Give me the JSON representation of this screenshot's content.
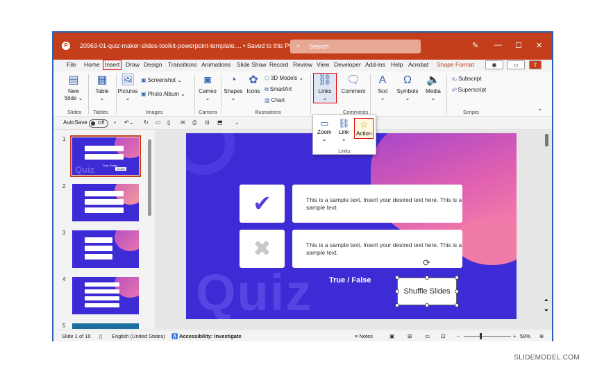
{
  "title_bar": {
    "logo": "P",
    "doc_title": "20963-01-quiz-maker-slides-toolkit-powerpoint-template....  •  Saved to this PC ⌄",
    "search_placeholder": "Search",
    "icons": [
      "pen-icon",
      "minimize-icon",
      "maximize-icon",
      "close-icon"
    ]
  },
  "menu": {
    "tabs": [
      "File",
      "Home",
      "Insert",
      "Draw",
      "Design",
      "Transitions",
      "Animations",
      "Slide Show",
      "Record",
      "Review",
      "View",
      "Developer",
      "Add-ins",
      "Help",
      "Acrobat",
      "Shape Format"
    ],
    "active_tab": "Insert"
  },
  "ribbon": {
    "new_slide": "New\nSlide ⌄",
    "table": "Table\n⌄",
    "pictures": "Pictures\n⌄",
    "screenshot": "Screenshot ⌄",
    "photo_album": "Photo Album ⌄",
    "cameo": "Cameo\n⌄",
    "shapes": "Shapes\n⌄",
    "icons": "Icons",
    "models_3d": "3D Models ⌄",
    "smartart": "SmartArt",
    "chart": "Chart",
    "links": "Links\n⌄",
    "comment": "Comment",
    "text": "Text\n⌄",
    "symbols": "Symbols\n⌄",
    "media": "Media\n⌄",
    "subscript": "Subscript",
    "superscript": "Superscript",
    "groups": {
      "slides": "Slides",
      "tables": "Tables",
      "images": "Images",
      "camera": "Camera",
      "illustrations": "Illustrations",
      "comments": "Comments",
      "scripts": "Scripts"
    }
  },
  "qat": {
    "autosave": "AutoSave",
    "toggle": "Off"
  },
  "links_dropdown": {
    "zoom": "Zoom\n⌄",
    "link": "Link\n⌄",
    "action": "Action",
    "label": "Links"
  },
  "thumbnails": {
    "numbers": [
      "1",
      "2",
      "3",
      "4",
      "5"
    ],
    "slide1_small_text": "True / False",
    "slide1_small_button": "Shuffle"
  },
  "slide": {
    "quiz_word": "Quiz",
    "check_mark": "✔",
    "cross_mark": "✖",
    "text1": "This is a sample text. Insert your desired text here. This is a sample text.",
    "text2": "This is a sample text. Insert your desired text here. This is a sample text.",
    "true_false": "True / False",
    "shuffle_button": "Shuffle Slides"
  },
  "status_bar": {
    "slide_count": "Slide 1 of 10",
    "language": "English (United States)",
    "accessibility": "Accessibility: Investigate",
    "notes": "Notes",
    "zoom_minus": "−",
    "zoom_plus": "+",
    "zoom_level": "59%"
  },
  "watermark": "SLIDEMODEL.COM",
  "colors": {
    "accent": "#c43e1c",
    "slide_bg": "#3d2bd6",
    "highlight": "#dd0000"
  }
}
